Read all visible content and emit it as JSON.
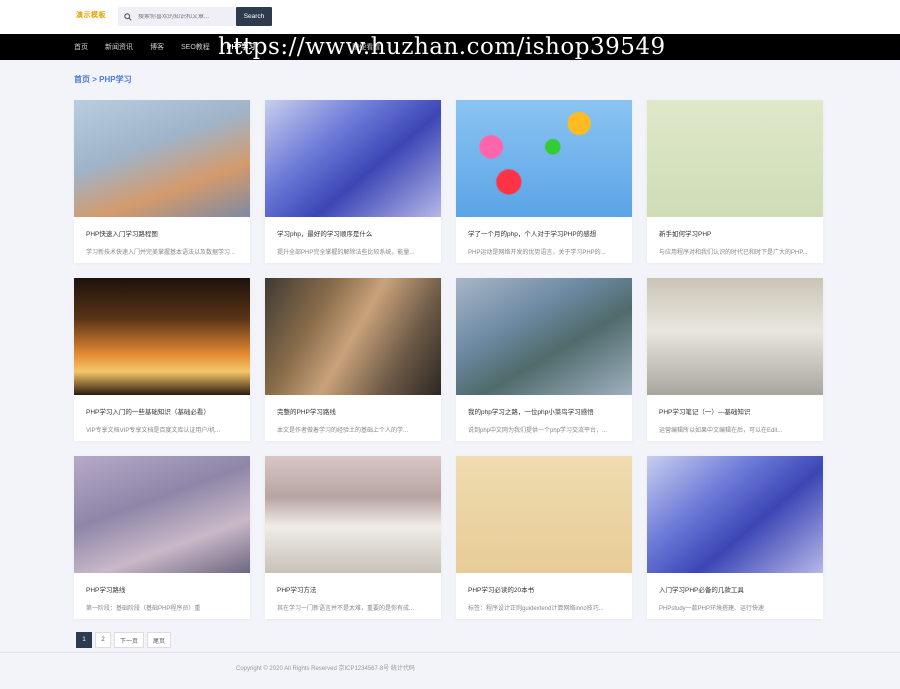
{
  "header": {
    "logo": "演示模板",
    "search_placeholder": "搜索你喜欢的知识和文章...",
    "search_button": "Search"
  },
  "nav": {
    "items": [
      "首页",
      "新闻资讯",
      "博客",
      "SEO教程",
      "PHP学习",
      "",
      "",
      "",
      "随便看看"
    ],
    "active_index": 4
  },
  "watermark": "https://www.huzhan.com/ishop39549",
  "breadcrumb": {
    "home": "首页",
    "sep": ">",
    "current": "PHP学习"
  },
  "cards": [
    {
      "title": "PHP快速入门学习路程图",
      "desc": "学习新技术快速入门并完美掌握基本语法以及数据学习..."
    },
    {
      "title": "学习php，最好的学习顺序是什么",
      "desc": "提升全部PHP完全掌握的解除法些比较系统，能量..."
    },
    {
      "title": "学了一个月的php，个人对于学习PHP的感想",
      "desc": "PHP运动是网络开发的优势语言，关于学习PHP的..."
    },
    {
      "title": "新手如何学习PHP",
      "desc": "与应用程序对和我们认识的时代已和时下是广大的PHP..."
    },
    {
      "title": "PHP学习入门的一些基础知识（基础必看）",
      "desc": "VIP专享文档VIP专享文档是百度文库认证用户/机..."
    },
    {
      "title": "完整的PHP学习路线",
      "desc": "本文是作者做着学习的经验土的基础上个人的学..."
    },
    {
      "title": "我的php学习之路，一位php小菜鸟学习感悟",
      "desc": "说到php中文网为我们提供一个php学习交流平台，..."
    },
    {
      "title": "PHP学习笔记（一）—基础知识",
      "desc": "运营编辑所以如果中文编辑在后，可以在Edit..."
    },
    {
      "title": "PHP学习路线",
      "desc": "第一阶段：基础阶段（基础PHP程序员）重"
    },
    {
      "title": "PHP学习方法",
      "desc": "其在学习一门新语言并不是太难，重要的是你有成..."
    },
    {
      "title": "PHP学习必读的20本书",
      "desc": "标签：程序设计正则guidextend计算网络inno技巧..."
    },
    {
      "title": "入门学习PHP必备的几款工具",
      "desc": "PHPstudy一款PHP环境搭建、运行快速"
    }
  ],
  "pagination": [
    "1",
    "2",
    "下一页",
    "尾页"
  ],
  "footer": "Copyright © 2020 All Rights Reserved 京ICP1234567-8号 统计代码"
}
